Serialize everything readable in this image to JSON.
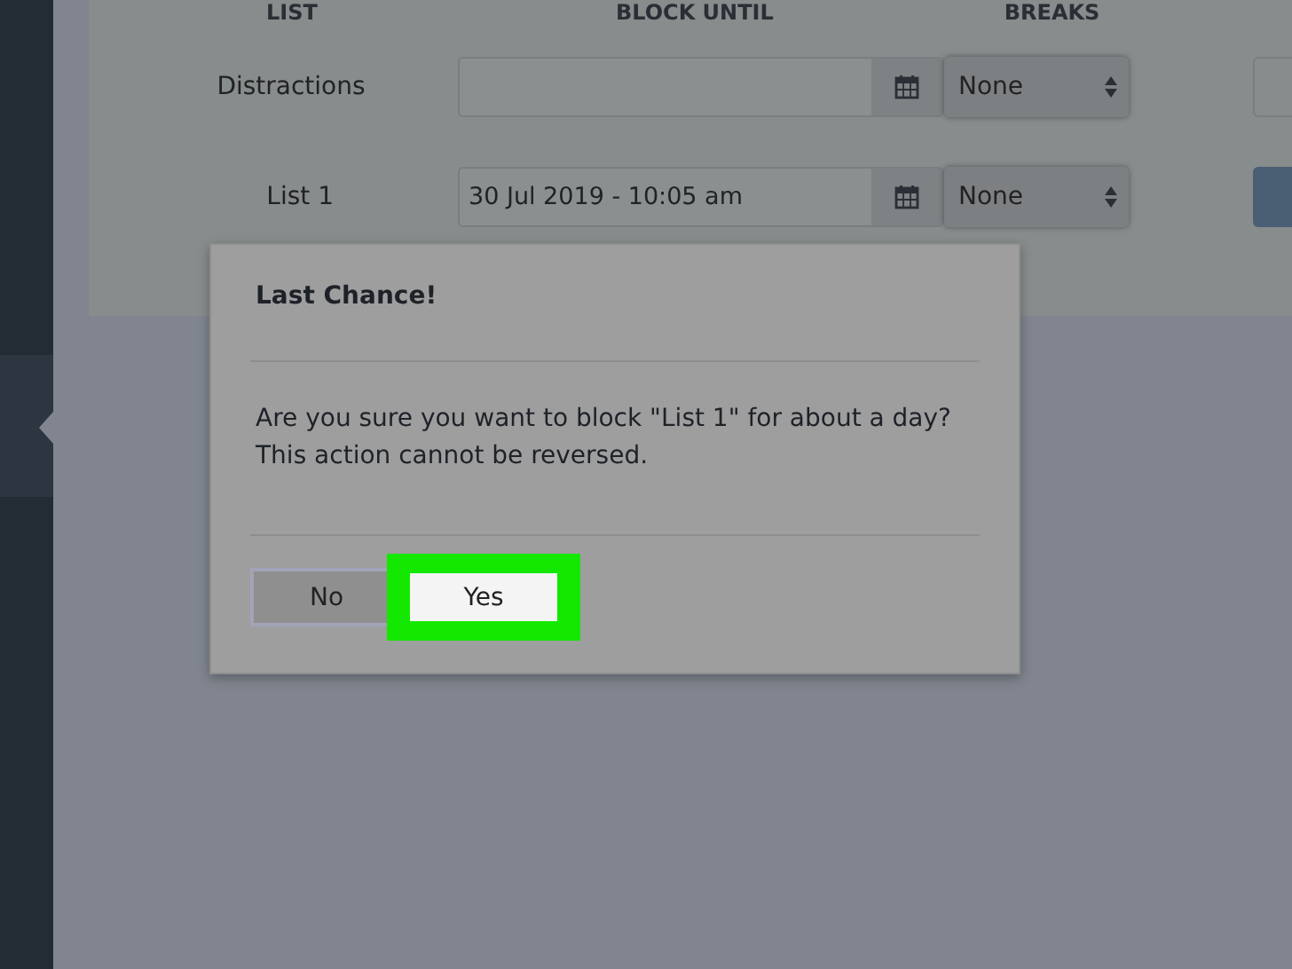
{
  "table": {
    "columns": [
      "LIST",
      "BLOCK UNTIL",
      "BREAKS"
    ],
    "rows": [
      {
        "list": "Distractions",
        "breaks": "None"
      },
      {
        "list": "List 1",
        "block_until": "30 Jul 2019 - 10:05 am",
        "breaks": "None"
      }
    ]
  },
  "dialog": {
    "title": "Last Chance!",
    "message": "Are you sure you want to block \"List 1\" for about a day? This action cannot be reversed.",
    "buttons": [
      {
        "label": "No",
        "highlighted": false
      },
      {
        "label": "Yes",
        "highlighted": true
      }
    ]
  }
}
